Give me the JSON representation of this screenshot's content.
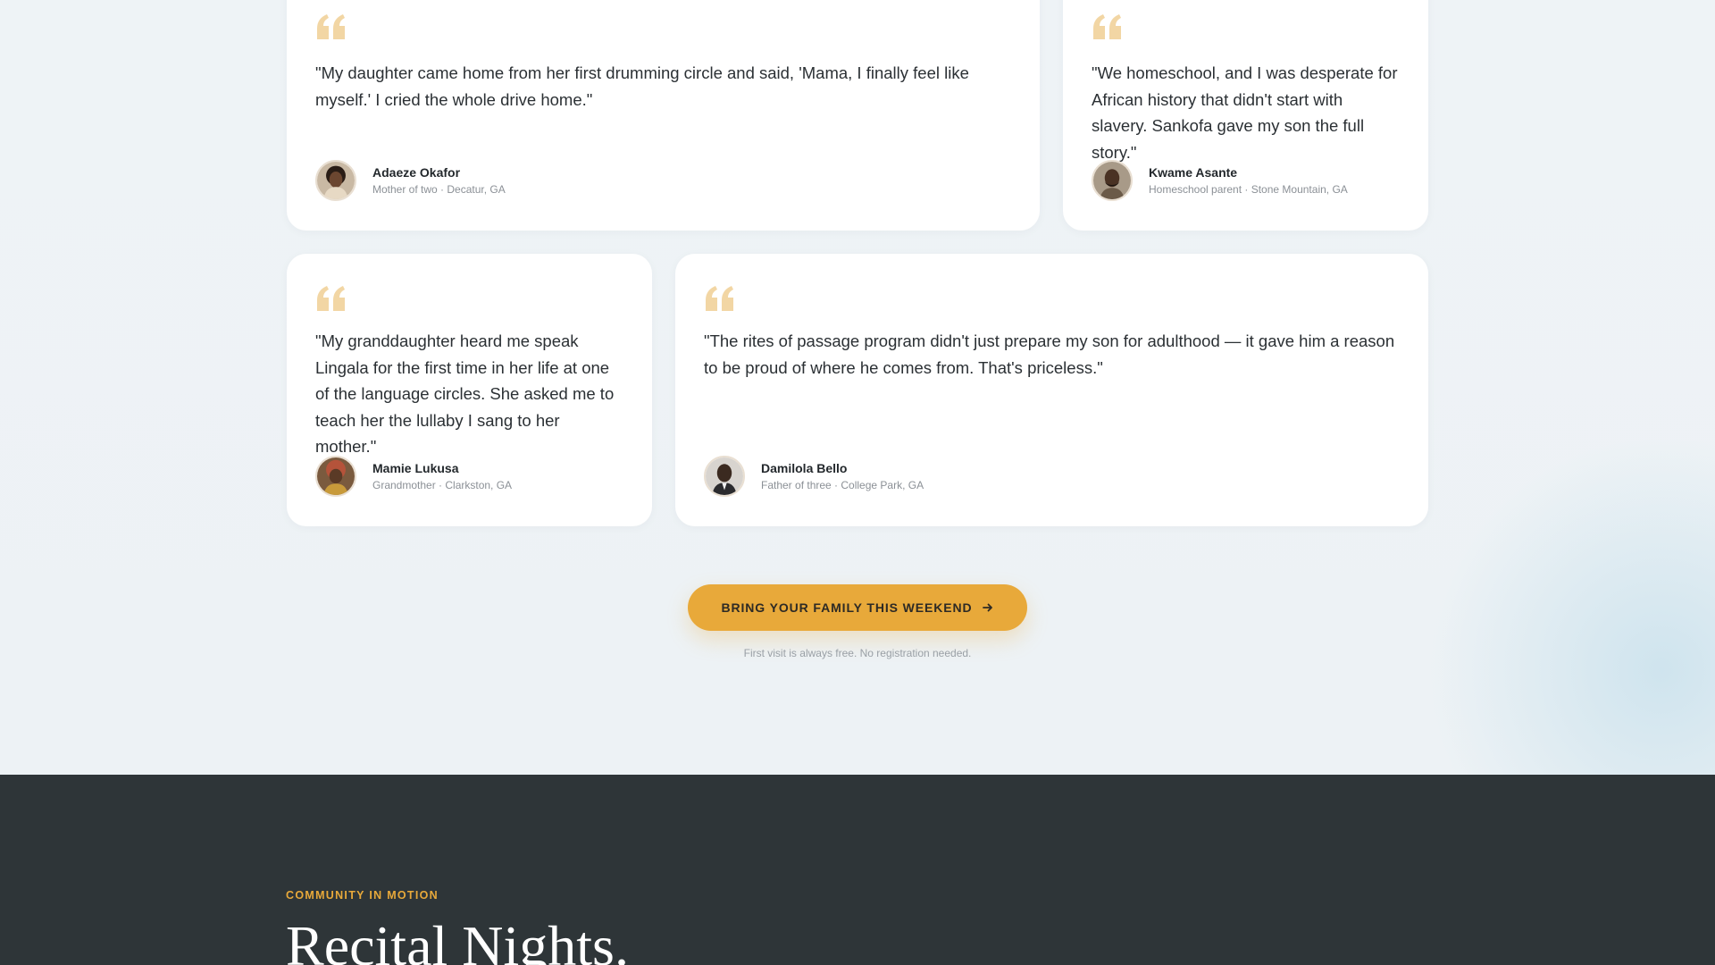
{
  "testimonials": [
    {
      "quote": "\"My daughter came home from her first drumming circle and said, 'Mama, I finally feel like myself.' I cried the whole drive home.\"",
      "name": "Adaeze Okafor",
      "meta": "Mother of two · Decatur, GA",
      "avatar_icon": "woman-portrait"
    },
    {
      "quote": "\"We homeschool, and I was desperate for African history that didn't start with slavery. Sankofa gave my son the full story.\"",
      "name": "Kwame Asante",
      "meta": "Homeschool parent · Stone Mountain, GA",
      "avatar_icon": "man-portrait"
    },
    {
      "quote": "\"My granddaughter heard me speak Lingala for the first time in her life at one of the language circles. She asked me to teach her the lullaby I sang to her mother.\"",
      "name": "Mamie Lukusa",
      "meta": "Grandmother · Clarkston, GA",
      "avatar_icon": "grandmother-portrait"
    },
    {
      "quote": "\"The rites of passage program didn't just prepare my son for adulthood — it gave him a reason to be proud of where he comes from. That's priceless.\"",
      "name": "Damilola Bello",
      "meta": "Father of three · College Park, GA",
      "avatar_icon": "man-portrait-suit"
    }
  ],
  "cta": {
    "label": "BRING YOUR FAMILY THIS WEEKEND",
    "note": "First visit is always free. No registration needed.",
    "icon": "arrow-right-icon"
  },
  "next_section": {
    "eyebrow": "COMMUNITY IN MOTION",
    "title": "Recital Nights."
  },
  "colors": {
    "accent": "#e8a93a",
    "quote_mark": "#f2d6a4",
    "dark_bg": "#2e3538",
    "page_bg": "#edf2f5"
  }
}
